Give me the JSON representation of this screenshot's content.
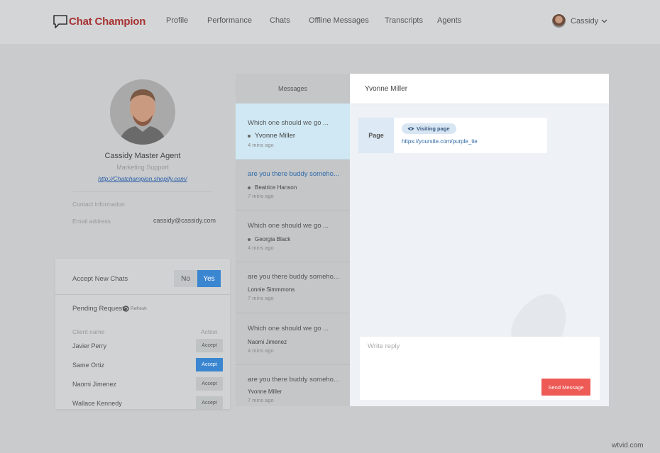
{
  "header": {
    "logo_text": "Chat Champion",
    "nav": [
      "Profile",
      "Performance",
      "Chats",
      "Offline Messages",
      "Transcripts",
      "Agents"
    ],
    "user_name": "Cassidy"
  },
  "profile": {
    "name": "Cassidy Master Agent",
    "role": "Marketing Support",
    "url": "http://Chatchampion.shopify.com/",
    "contact_label": "Contact information",
    "email_label": "Email address",
    "email_value": "cassidy@cassidy.com"
  },
  "pending": {
    "accept_label": "Accept New Chats",
    "no_label": "No",
    "yes_label": "Yes",
    "selected": "Yes",
    "title": "Pending Request",
    "refresh_label": "Refresh",
    "col_client": "Client name",
    "col_action": "Action",
    "requests": [
      {
        "name": "Javier Perry",
        "action": "Accept",
        "active": false
      },
      {
        "name": "Same Ortiz",
        "action": "Accept",
        "active": true
      },
      {
        "name": "Naomi Jimenez",
        "action": "Accept",
        "active": false
      },
      {
        "name": "Wallace Kennedy",
        "action": "Accept",
        "active": false
      }
    ]
  },
  "messages": {
    "header": "Messages",
    "items": [
      {
        "text": "Which one should we go ...",
        "name": "Yvonne Miller",
        "time": "4 mins ago",
        "dot": true,
        "active": true
      },
      {
        "text": "are you there buddy someho...",
        "name": "Beatrice Hanson",
        "time": "7 mins ago",
        "dot": true,
        "active": false
      },
      {
        "text": "Which one should we go ...",
        "name": "Georgia Black",
        "time": "4 mins ago",
        "dot": true,
        "active": false
      },
      {
        "text": "are you there buddy someho...",
        "name": "Lonnie Simmmons",
        "time": "7 mins ago",
        "dot": false,
        "active": false
      },
      {
        "text": "Which one should we go ...",
        "name": "Naomi Jimenez",
        "time": "4 mins ago",
        "dot": false,
        "active": false
      },
      {
        "text": "are you there buddy someho...",
        "name": "Yvonne Miller",
        "time": "7 mins ago",
        "dot": false,
        "active": false
      }
    ]
  },
  "chat": {
    "contact_name": "Yvonne Miller",
    "page_label": "Page",
    "visiting_label": "Visiting page",
    "visiting_url": "https://yoursite.com/purple_tie",
    "reply_placeholder": "Write reply",
    "send_label": "Send Message"
  },
  "watermark": "wtvid.com",
  "colors": {
    "brand_red": "#a83232",
    "accent_blue": "#3b86d1",
    "send_red": "#ee5a55",
    "active_message_bg": "#cfe8f4"
  },
  "icons": [
    "chat-bubble-icon",
    "chevron-down-icon",
    "refresh-icon",
    "eye-icon"
  ]
}
